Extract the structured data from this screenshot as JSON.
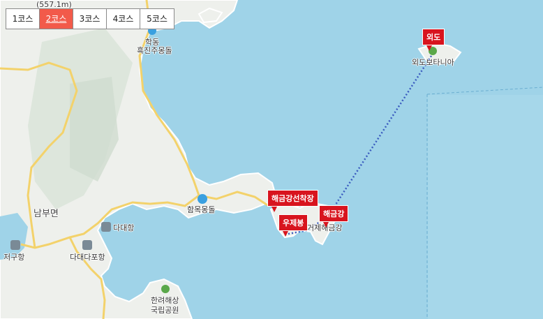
{
  "tabs": [
    {
      "label": "1코스"
    },
    {
      "label": "2코스"
    },
    {
      "label": "3코스"
    },
    {
      "label": "4코스"
    },
    {
      "label": "5코스"
    }
  ],
  "active_tab": 1,
  "flags": {
    "oedo": "외도",
    "haegeumgang_dock": "해금강선착장",
    "ujebong": "우제봉",
    "haegeumgang": "해금강"
  },
  "labels": {
    "elevation": "(557.1m)",
    "hakdong": "학동",
    "heukjin": "흑진주몽돌",
    "hammok": "함목몽돌",
    "nambu": "남부면",
    "dadaehang": "다대항",
    "dadaedapo": "다대다포항",
    "jeoguhang": "저구항",
    "oedo_botania": "외도보타니아",
    "geoje_haegeumgang": "거제해금강",
    "hallyeo": "한려해상",
    "national_park": "국립공원"
  },
  "colors": {
    "sea": "#9fd3e8",
    "land": "#eef0ec",
    "road": "#f3d26b",
    "route": "#3a5bbf",
    "flag": "#d8141e",
    "active_tab": "#f25a4a"
  }
}
